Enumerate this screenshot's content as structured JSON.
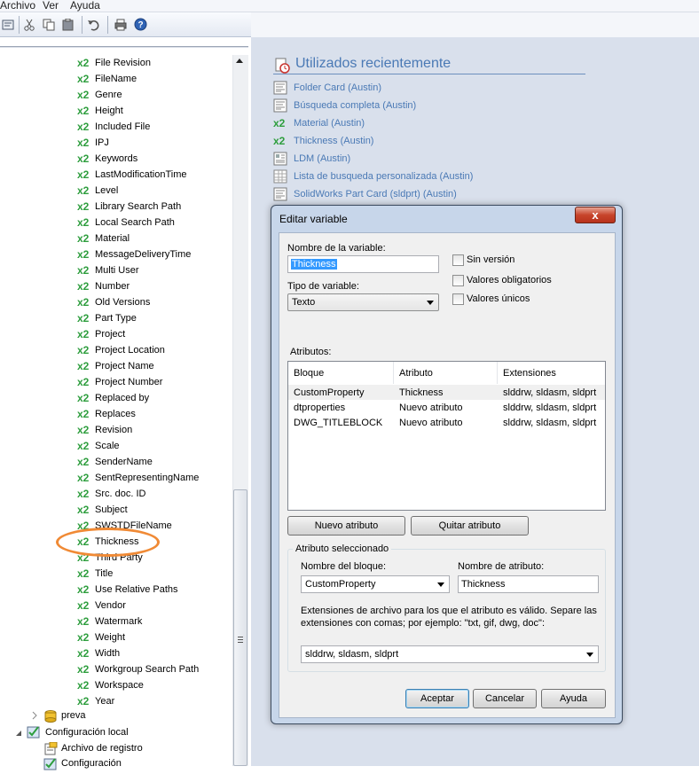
{
  "menu": {
    "archivo": "Archivo",
    "ver": "Ver",
    "ayuda": "Ayuda"
  },
  "toolbar": {
    "buttons": [
      "properties-icon",
      "cut-icon",
      "copy-icon",
      "paste-icon",
      "undo-icon",
      "print-icon",
      "help-icon"
    ]
  },
  "tree": {
    "badge": "x2",
    "items": [
      "File Revision",
      "FileName",
      "Genre",
      "Height",
      "Included File",
      "IPJ",
      "Keywords",
      "LastModificationTime",
      "Level",
      "Library Search Path",
      "Local Search Path",
      "Material",
      "MessageDeliveryTime",
      "Multi User",
      "Number",
      "Old Versions",
      "Part Type",
      "Project",
      "Project Location",
      "Project Name",
      "Project Number",
      "Replaced by",
      "Replaces",
      "Revision",
      "Scale",
      "SenderName",
      "SentRepresentingName",
      "Src. doc. ID",
      "Subject",
      "SWSTDFileName",
      "Thickness",
      "Third Party",
      "Title",
      "Use Relative Paths",
      "Vendor",
      "Watermark",
      "Weight",
      "Width",
      "Workgroup Search Path",
      "Workspace",
      "Year"
    ],
    "preva": "preva",
    "config_local": "Configuración local",
    "archivo_registro": "Archivo de registro",
    "configuracion": "Configuración"
  },
  "recent": {
    "title": "Utilizados recientemente",
    "items": [
      {
        "label": "Folder Card (Austin)",
        "icon": "card-icon"
      },
      {
        "label": "Búsqueda completa (Austin)",
        "icon": "card-icon"
      },
      {
        "label": "Material (Austin)",
        "icon": "x2"
      },
      {
        "label": "Thickness (Austin)",
        "icon": "x2"
      },
      {
        "label": "LDM (Austin)",
        "icon": "bom-icon"
      },
      {
        "label": "Lista de busqueda personalizada (Austin)",
        "icon": "grid-icon"
      },
      {
        "label": "SolidWorks Part Card  (sldprt) (Austin)",
        "icon": "card-icon"
      }
    ]
  },
  "dialog": {
    "title": "Editar variable",
    "close": "x",
    "var_name_label": "Nombre de la variable:",
    "var_name_value": "Thickness",
    "type_label": "Tipo de variable:",
    "type_value": "Texto",
    "chk_sin_version": "Sin versión",
    "chk_obligatorios": "Valores obligatorios",
    "chk_unicos": "Valores únicos",
    "attrs_label": "Atributos:",
    "columns": [
      "Bloque",
      "Atributo",
      "Extensiones"
    ],
    "rows": [
      [
        "CustomProperty",
        "Thickness",
        "slddrw, sldasm, sldprt"
      ],
      [
        "dtproperties",
        "Nuevo atributo",
        "slddrw, sldasm, sldprt"
      ],
      [
        "DWG_TITLEBLOCK",
        "Nuevo atributo",
        "slddrw, sldasm, sldprt"
      ]
    ],
    "btn_new_attr": "Nuevo atributo",
    "btn_remove_attr": "Quitar atributo",
    "group_title": "Atributo seleccionado",
    "block_name_label": "Nombre del bloque:",
    "block_name_value": "CustomProperty",
    "attr_name_label": "Nombre de atributo:",
    "attr_name_value": "Thickness",
    "ext_help": "Extensiones de archivo para los que el atributo es válido. Separe las extensiones con comas; por ejemplo: \"txt, gif, dwg, doc\":",
    "ext_value": "slddrw, sldasm, sldprt",
    "btn_ok": "Aceptar",
    "btn_cancel": "Cancelar",
    "btn_help": "Ayuda"
  },
  "colors": {
    "accent_blue": "#4a79b5",
    "x2_green": "#2e9e3e",
    "highlight_orange": "#f08a35",
    "panel_bg": "#d9e0ec"
  }
}
